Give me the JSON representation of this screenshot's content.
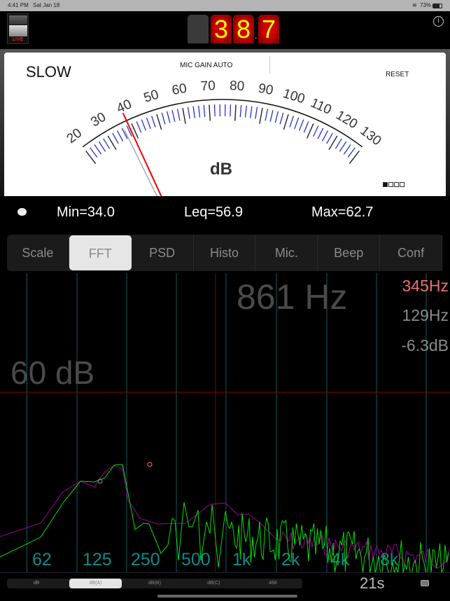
{
  "status_bar": {
    "time": "4:41 PM",
    "date": "Sat Jan 18",
    "battery": "73%"
  },
  "top": {
    "live_label": "LIVE",
    "digits": [
      "3",
      "8",
      "7"
    ],
    "decimal": ".",
    "level_db": 38.7
  },
  "meter": {
    "mode": "SLOW",
    "mic_gain": "MIC GAIN AUTO",
    "reset": "RESET",
    "unit": "dB",
    "min_label": "MIN",
    "max_label": "MAX",
    "scale_labels": [
      "20",
      "30",
      "40",
      "50",
      "60",
      "70",
      "80",
      "90",
      "100",
      "110",
      "120",
      "130"
    ],
    "scale_min": 20,
    "scale_max": 130,
    "needle_value": 38.7,
    "slow_needle_value": 36.5,
    "min_value": 34.0,
    "max_value": 62.7,
    "page_index": 0,
    "page_count": 4
  },
  "stats": {
    "min": "Min=34.0",
    "leq": "Leq=56.9",
    "max": "Max=62.7"
  },
  "tabs": [
    {
      "label": "Scale"
    },
    {
      "label": "FFT",
      "selected": true
    },
    {
      "label": "PSD"
    },
    {
      "label": "Histo"
    },
    {
      "label": "Mic."
    },
    {
      "label": "Beep"
    },
    {
      "label": "Conf"
    }
  ],
  "fft": {
    "cursor_freq": "861 Hz",
    "cursor_level": "60 dB",
    "peak_freq": "345Hz",
    "resolution": "129Hz",
    "gain": "-6.3dB",
    "freq_labels": [
      "62",
      "125",
      "250",
      "500",
      "1k",
      "2k",
      "4k",
      "8k"
    ],
    "colors": {
      "grid": "#0e5a5a",
      "cursor": "#8b0000",
      "label": "#0f8a8a",
      "live": "#00e000",
      "average": "#a000a0",
      "peak": "#ff7070"
    }
  },
  "bottom": {
    "weightings": [
      "dB",
      "dB(A)",
      "dB(B)",
      "dB(C)",
      "468"
    ],
    "selected_weighting": 1,
    "elapsed": "21s"
  }
}
